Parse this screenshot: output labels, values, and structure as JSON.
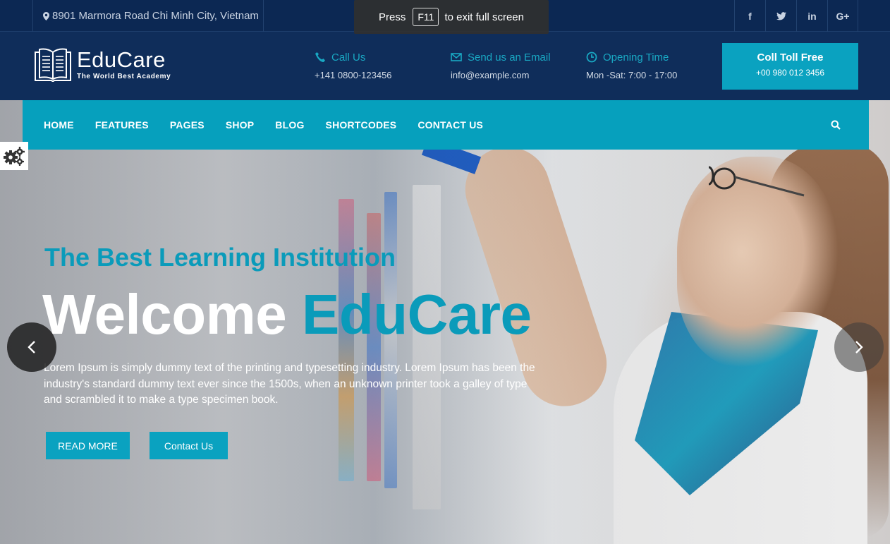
{
  "topbar": {
    "address": "8901 Marmora Road Chi Minh City, Vietnam",
    "social": [
      {
        "icon": "facebook-icon",
        "glyph": "f"
      },
      {
        "icon": "twitter-icon",
        "glyph": "t"
      },
      {
        "icon": "linkedin-icon",
        "glyph": "in"
      },
      {
        "icon": "google-plus-icon",
        "glyph": "G+"
      }
    ]
  },
  "fullscreen_notice": {
    "press": "Press",
    "key": "F11",
    "rest": "to exit full screen"
  },
  "logo": {
    "name": "EduCare",
    "tagline": "The World Best Academy"
  },
  "contact": {
    "call": {
      "label": "Call Us",
      "value": "+141 0800-123456"
    },
    "email": {
      "label": "Send us an Email",
      "value": "info@example.com"
    },
    "hours": {
      "label": "Opening Time",
      "value": "Mon -Sat: 7:00 - 17:00"
    }
  },
  "toll": {
    "title": "Coll Toll Free",
    "number": "+00 980 012 3456"
  },
  "nav": {
    "items": [
      "HOME",
      "FEATURES",
      "PAGES",
      "SHOP",
      "BLOG",
      "SHORTCODES",
      "CONTACT US"
    ]
  },
  "hero": {
    "subtitle": "The Best Learning Institution",
    "welcome_white": "Welcome",
    "welcome_accent": "EduCare",
    "description": "Lorem Ipsum is simply dummy text of the printing and typesetting industry. Lorem Ipsum has been the industry's standard dummy text ever since the 1500s, when an unknown printer took a galley of type and scrambled it to make a type specimen book.",
    "btn_read_more": "READ MORE",
    "btn_contact": "Contact Us"
  },
  "colors": {
    "accent": "#0aa2c0",
    "navy": "#0f2d5a",
    "topbar": "#0c2853"
  }
}
